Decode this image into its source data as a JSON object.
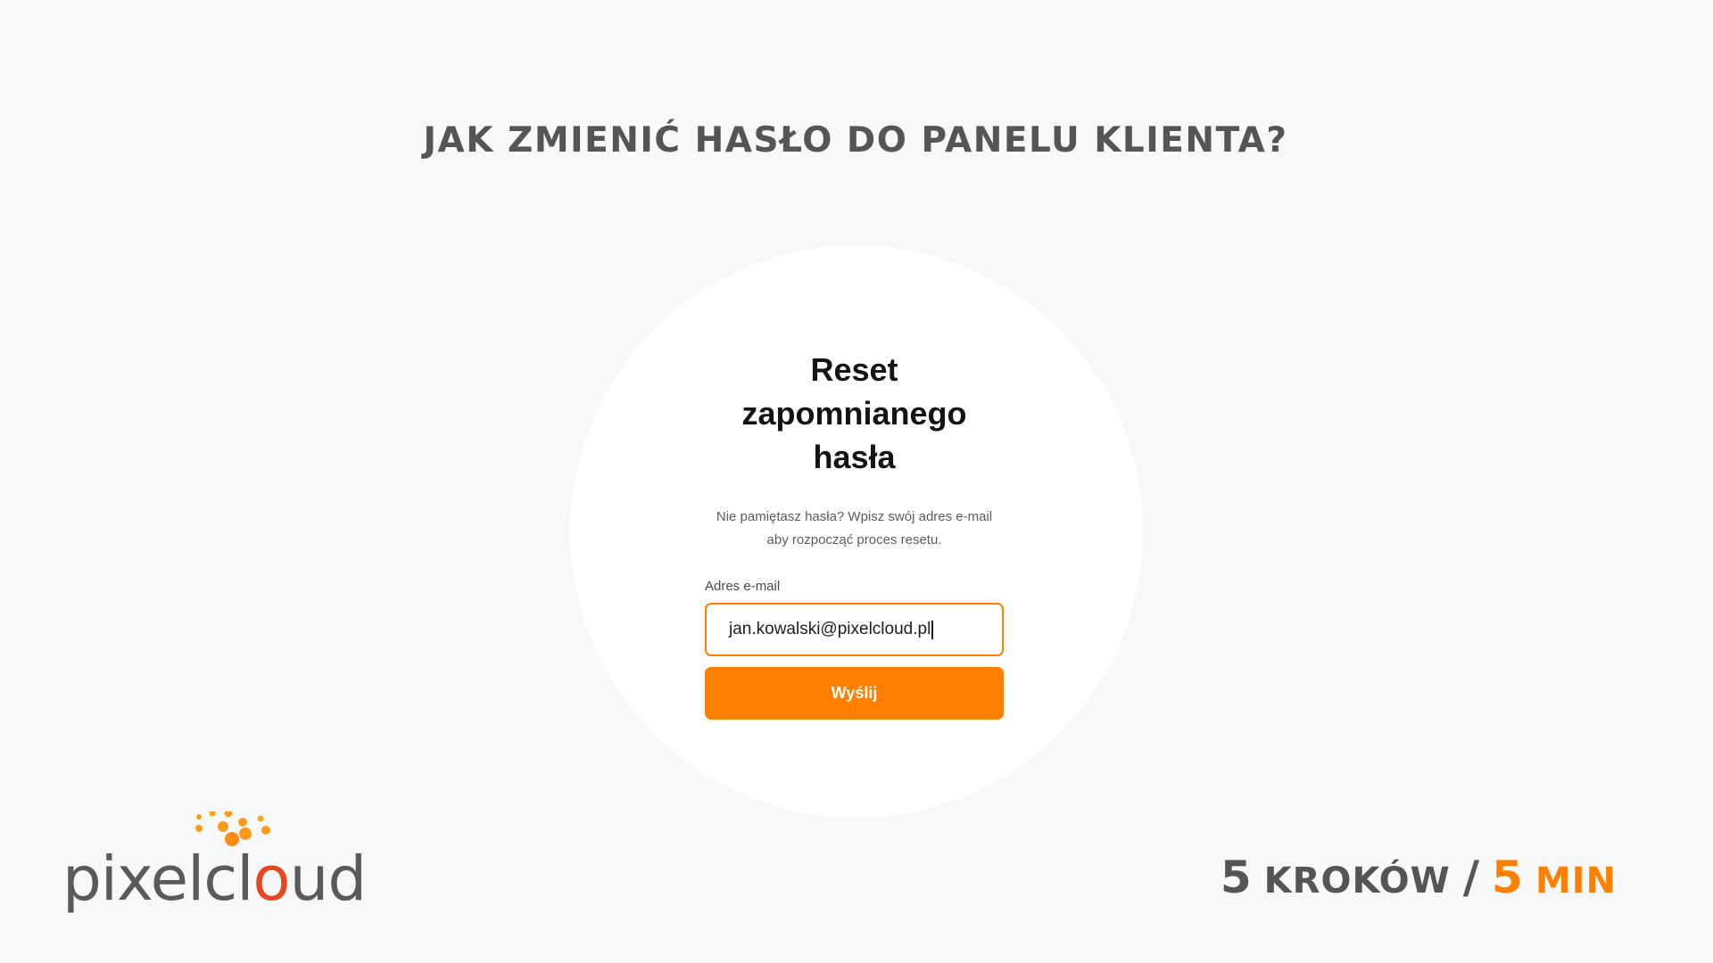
{
  "page": {
    "heading": "JAK ZMIENIĆ HASŁO DO PANELU KLIENTA?"
  },
  "form": {
    "title": "Reset zapomnianego hasła",
    "description": "Nie pamiętasz hasła? Wpisz swój adres e-mail aby rozpocząć proces resetu.",
    "email_label": "Adres e-mail",
    "email_value": "jan.kowalski@pixelcloud.pl",
    "submit_label": "Wyślij"
  },
  "brand": {
    "logo_text_before": "pixelcl",
    "logo_text_o": "o",
    "logo_text_after": "ud",
    "accent_color": "#ff7f00",
    "logo_icon": "pixelcloud-logo"
  },
  "tagline": {
    "steps_number": "5",
    "steps_word": "KROKÓW",
    "separator": "/",
    "minutes_number": "5",
    "minutes_word": "MIN"
  },
  "colors": {
    "background": "#f7f8fa",
    "heading": "#555555",
    "accent": "#ff7f00"
  }
}
